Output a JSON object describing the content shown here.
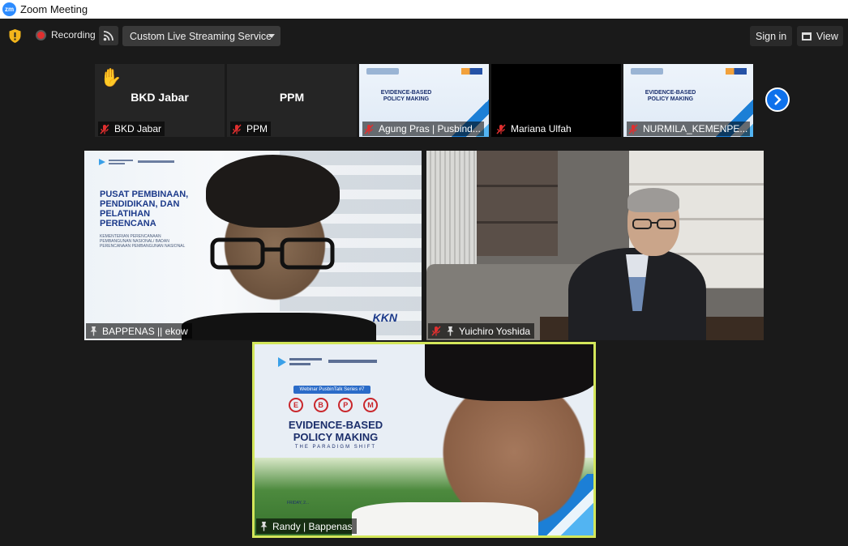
{
  "window": {
    "title": "Zoom Meeting",
    "logo_text": "zm"
  },
  "toolbar": {
    "recording_label": "Recording",
    "stream_service": "Custom Live Streaming Service",
    "sign_in_label": "Sign in",
    "view_label": "View"
  },
  "thumbnails": [
    {
      "label": "BKD Jabar",
      "center_name": "BKD Jabar",
      "muted": true,
      "raised_hand": true,
      "has_slide": false
    },
    {
      "label": "PPM",
      "center_name": "PPM",
      "muted": true,
      "raised_hand": false,
      "has_slide": false
    },
    {
      "label": "Agung Pras | Pusbind...",
      "center_name": "",
      "muted": true,
      "raised_hand": false,
      "has_slide": true
    },
    {
      "label": "Mariana Ulfah",
      "center_name": "",
      "muted": true,
      "raised_hand": false,
      "has_slide": false
    },
    {
      "label": "NURMILA_KEMENPE...",
      "center_name": "",
      "muted": true,
      "raised_hand": false,
      "has_slide": true
    }
  ],
  "slide_text": {
    "thumb_title": "EVIDENCE-BASED POLICY MAKING"
  },
  "tiles": {
    "tile1": {
      "label": "BAPPENAS || ekow",
      "slide_title": "PUSAT PEMBINAAN, PENDIDIKAN, DAN PELATIHAN PERENCANA",
      "slide_small": "KEMENTERIAN PERENCANAAN PEMBANGUNAN NASIONAL/ BADAN PERENCANAAN PEMBANGUNAN NASIONAL",
      "logo_text": "Kementerian PPN/ Bappenas | Pusbindiklatren",
      "corner_text": "KKN"
    },
    "tile2": {
      "label": "Yuichiro Yoshida"
    },
    "tile3": {
      "label": "Randy | Bappenas",
      "logo_text": "Kementerian PPN/ Bappenas | Pusbindiklatren",
      "webinar_text": "Webinar PusbinTalk Series #7",
      "ebpm_letters": [
        "E",
        "B",
        "P",
        "M"
      ],
      "title": "EVIDENCE-BASED POLICY MAKING",
      "subtitle": "THE PARADIGM SHIFT",
      "friday_text": "FRIDAY, 2..."
    }
  },
  "colors": {
    "accent": "#0e71eb",
    "active_speaker_border": "#d3e65a",
    "mute_red": "#e02f2f"
  }
}
